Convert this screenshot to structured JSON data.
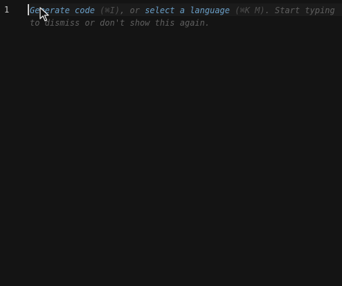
{
  "editor": {
    "line_number": "1",
    "hint": {
      "link_generate": "Generate code",
      "shortcut_generate": "(⌘I)",
      "connector": ", or ",
      "link_language": "select a language",
      "shortcut_language": "(⌘K M)",
      "tail": ". Start typing to dismiss or don't show this again."
    }
  },
  "colors": {
    "background": "#141414",
    "line_number": "#cccccc",
    "hint_text": "#5f5f5f",
    "hint_link": "#6a9fc8"
  },
  "icons": {
    "pointer": "mouse-pointer-icon"
  }
}
